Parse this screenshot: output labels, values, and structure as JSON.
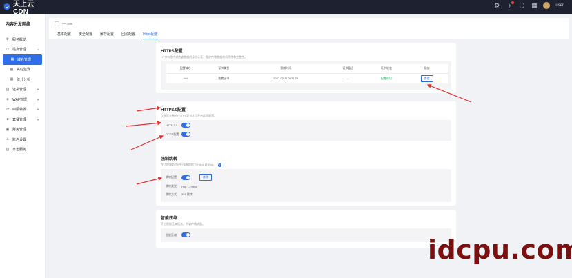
{
  "app": {
    "brand": "天上云CDN",
    "user": "user"
  },
  "sidebar": {
    "title": "内容分发网络",
    "items": [
      {
        "label": "服务概览",
        "icon": "gear-icon",
        "glyph": "⚙"
      },
      {
        "label": "站点管理",
        "icon": "monitor-icon",
        "glyph": "▭"
      },
      {
        "label": "域名管理",
        "icon": "grid-icon",
        "glyph": "▦"
      },
      {
        "label": "实时监测",
        "icon": "grid-icon",
        "glyph": "▦"
      },
      {
        "label": "统计分析",
        "icon": "grid-icon",
        "glyph": "▦"
      },
      {
        "label": "证书管理",
        "icon": "doc-icon",
        "glyph": "▤"
      },
      {
        "label": "WAF管理",
        "icon": "shield-icon",
        "glyph": "◈"
      },
      {
        "label": "四层转发",
        "icon": "link-icon",
        "glyph": "⇄"
      },
      {
        "label": "套餐管理",
        "icon": "box-icon",
        "glyph": "■"
      },
      {
        "label": "财务管理",
        "icon": "wallet-icon",
        "glyph": "▣"
      },
      {
        "label": "账户设置",
        "icon": "user-icon",
        "glyph": "♙"
      },
      {
        "label": "日志服务",
        "icon": "log-icon",
        "glyph": "▤"
      }
    ]
  },
  "breadcrumb": {
    "back": "‹",
    "domain": "****.com"
  },
  "tabs": [
    "基本配置",
    "安全配置",
    "缓存配置",
    "回源配置",
    "Https配置"
  ],
  "https_card": {
    "title": "HTTPS配置",
    "desc": "HTTPS提供对传输数据的身份认证，保护传输数据的机密性和完整性。",
    "columns": [
      "配置域名",
      "证书类型",
      "到期时间",
      "证书备注",
      "证书状态",
      "操作"
    ],
    "row": [
      "****",
      "免费证书",
      "2022-02-11 2021-24",
      "—",
      "配置成功",
      "查看"
    ]
  },
  "http2_card": {
    "title": "HTTP2.0配置",
    "desc": "仅配置完整的HTTPS证书才可开启此项配置。",
    "rows": [
      {
        "label": "HTTP 2.0"
      },
      {
        "label": "OCSP配置"
      }
    ]
  },
  "force_card": {
    "title": "强制跳转",
    "desc": "在边缘服务中进行强制跳转为 Https 或 Http。",
    "rows": [
      {
        "label": "跳转配置",
        "button": "修改"
      },
      {
        "label": "跳转类型",
        "value": "Http → Https"
      },
      {
        "label": "跳转方式",
        "value": "301 跳转"
      }
    ]
  },
  "smart_card": {
    "title": "智能压缩",
    "desc": "开启智能压缩服务，节省传输流量。",
    "rows": [
      {
        "label": "智能压缩"
      }
    ]
  },
  "watermark": "idcpu.com",
  "colors": {
    "accent": "#2e6ee6",
    "topbar": "#1d2130",
    "arrow": "#e53030",
    "watermark": "#7a1010"
  }
}
